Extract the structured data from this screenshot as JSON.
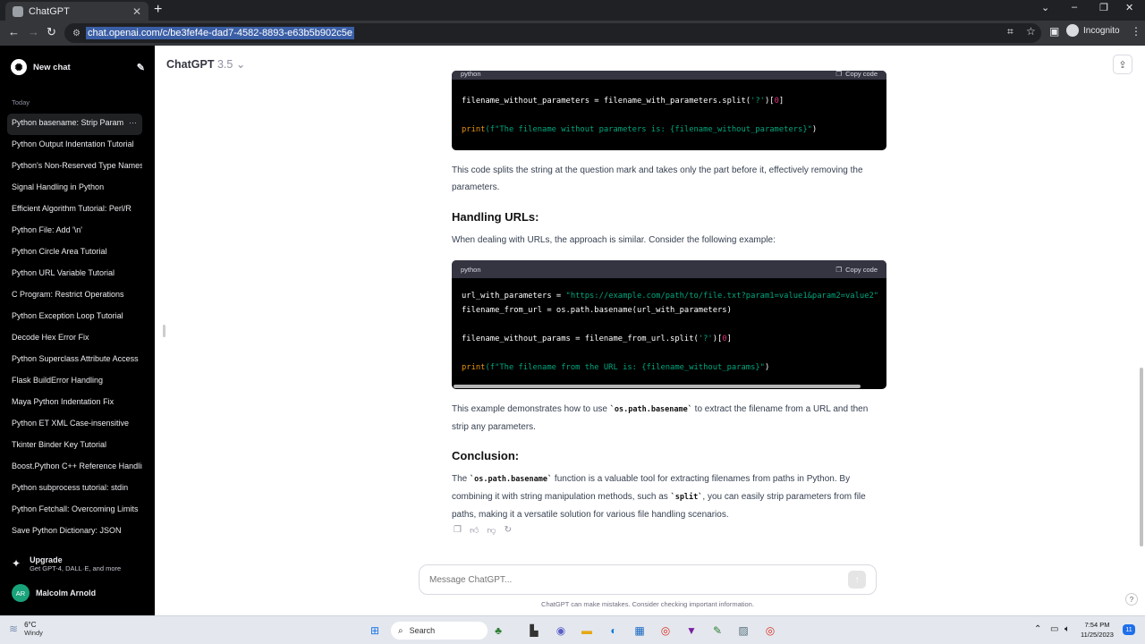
{
  "browser": {
    "tab_title": "ChatGPT",
    "tab_close": "✕",
    "new_tab": "+",
    "url": "chat.openai.com/c/be3fef4e-dad7-4582-8893-e63b5b902c5e",
    "incognito_label": "Incognito"
  },
  "sidebar": {
    "new_chat": "New chat",
    "section_today": "Today",
    "items": [
      {
        "label": "Python basename: Strip Param"
      },
      {
        "label": "Python Output Indentation Tutorial"
      },
      {
        "label": "Python's Non-Reserved Type Names"
      },
      {
        "label": "Signal Handling in Python"
      },
      {
        "label": "Efficient Algorithm Tutorial: Perl/R"
      },
      {
        "label": "Python File: Add '\\n'"
      },
      {
        "label": "Python Circle Area Tutorial"
      },
      {
        "label": "Python URL Variable Tutorial"
      },
      {
        "label": "C Program: Restrict Operations"
      },
      {
        "label": "Python Exception Loop Tutorial"
      },
      {
        "label": "Decode Hex Error Fix"
      },
      {
        "label": "Python Superclass Attribute Access"
      },
      {
        "label": "Flask BuildError Handling"
      },
      {
        "label": "Maya Python Indentation Fix"
      },
      {
        "label": "Python ET XML Case-insensitive"
      },
      {
        "label": "Tkinter Binder Key Tutorial"
      },
      {
        "label": "Boost.Python C++ Reference Handling"
      },
      {
        "label": "Python subprocess tutorial: stdin"
      },
      {
        "label": "Python Fetchall: Overcoming Limits"
      },
      {
        "label": "Save Python Dictionary: JSON"
      }
    ],
    "more_dots": "···",
    "upgrade_title": "Upgrade",
    "upgrade_sub": "Get GPT-4, DALL·E, and more",
    "user_initials": "AR",
    "user_name": "Malcolm Arnold"
  },
  "header": {
    "model": "ChatGPT",
    "version": "3.5"
  },
  "content": {
    "code1_lang": "python",
    "copy_label": "Copy code",
    "code1_line1": "filename_without_parameters = filename_with_parameters.split(",
    "code1_line1_str": "'?'",
    "code1_line1_mid": ")[",
    "code1_line1_num": "0",
    "code1_line1_end": "]",
    "code1_line2_fn": "print",
    "code1_line2_str": "(f\"The filename without parameters is: {filename_without_parameters}\"",
    "code1_line2_end": ")",
    "para1": "This code splits the string at the question mark and takes only the part before it, effectively removing the parameters.",
    "heading_urls": "Handling URLs:",
    "para2": "When dealing with URLs, the approach is similar. Consider the following example:",
    "code2_lang": "python",
    "code2_l1_a": "url_with_parameters = ",
    "code2_l1_str": "\"https://example.com/path/to/file.txt?param1=value1&param2=value2\"",
    "code2_l2": "filename_from_url = os.path.basename(url_with_parameters)",
    "code2_l3_a": "filename_without_params = filename_from_url.split(",
    "code2_l3_str": "'?'",
    "code2_l3_mid": ")[",
    "code2_l3_num": "0",
    "code2_l3_end": "]",
    "code2_l4_fn": "print",
    "code2_l4_str": "(f\"The filename from the URL is: {filename_without_params}\"",
    "code2_l4_end": ")",
    "para3_a": "This example demonstrates how to use ",
    "para3_code": "`os.path.basename`",
    "para3_b": " to extract the filename from a URL and then strip any parameters.",
    "heading_conclusion": "Conclusion:",
    "para4_a": "The ",
    "para4_code1": "`os.path.basename`",
    "para4_b": " function is a valuable tool for extracting filenames from paths in Python. By combining it with string manipulation methods, such as ",
    "para4_code2": "`split`",
    "para4_c": ", you can easily strip parameters from file paths, making it a versatile solution for various file handling scenarios."
  },
  "composer": {
    "placeholder": "Message ChatGPT...",
    "disclaimer": "ChatGPT can make mistakes. Consider checking important information.",
    "help": "?"
  },
  "taskbar": {
    "temp": "6°C",
    "weather": "Windy",
    "search": "Search",
    "time": "7:54 PM",
    "date": "11/25/2023",
    "notifications": "11"
  }
}
